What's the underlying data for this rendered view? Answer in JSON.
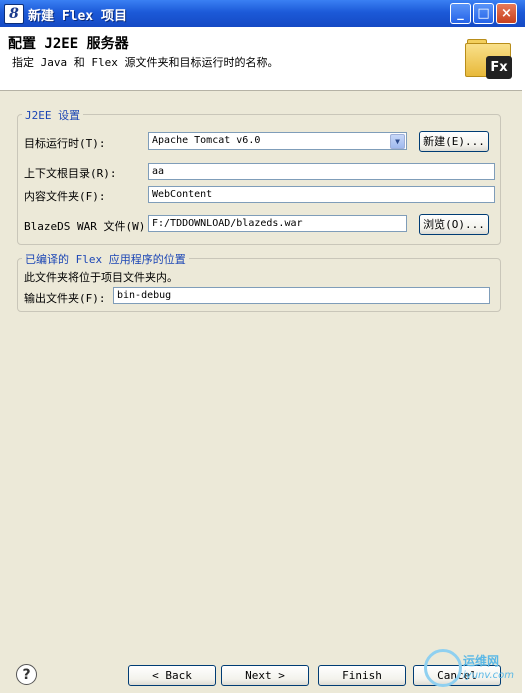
{
  "window": {
    "title": "新建 Flex 项目",
    "minimize": "_",
    "maximize": "□",
    "close": "×"
  },
  "header": {
    "title": "配置 J2EE 服务器",
    "description": "指定 Java 和 Flex 源文件夹和目标运行时的名称。"
  },
  "j2ee": {
    "group_label": "J2EE 设置",
    "runtime_label": "目标运行时(T):",
    "runtime_value": "Apache Tomcat v6.0",
    "new_button": "新建(E)...",
    "context_root_label": "上下文根目录(R):",
    "context_root_value": "aa",
    "content_folder_label": "内容文件夹(F):",
    "content_folder_value": "WebContent",
    "war_label": "BlazeDS WAR 文件(W):",
    "war_value": "F:/TDDOWNLOAD/blazeds.war",
    "browse_button": "浏览(O)..."
  },
  "output": {
    "group_label": "已编译的 Flex 应用程序的位置",
    "note": "此文件夹将位于项目文件夹内。",
    "folder_label": "输出文件夹(F):",
    "folder_value": "bin-debug"
  },
  "footer": {
    "help": "?",
    "back": "< Back",
    "next": "Next >",
    "finish": "Finish",
    "cancel": "Cancel"
  },
  "watermark": {
    "site": "运维网",
    "domain": "iyunv.com"
  }
}
